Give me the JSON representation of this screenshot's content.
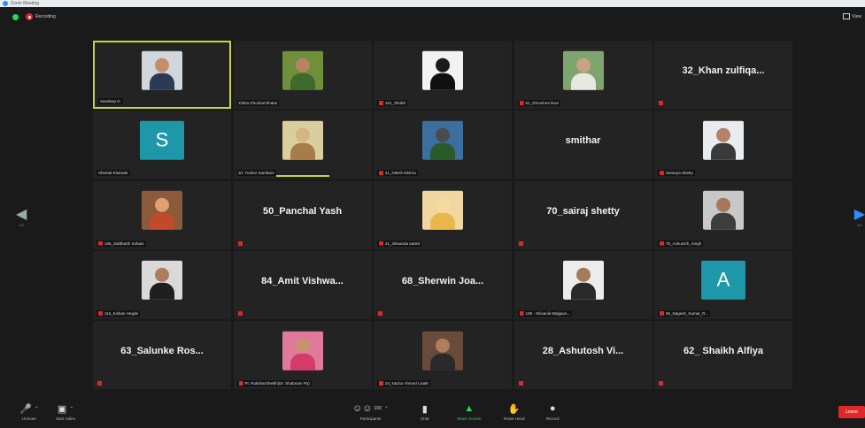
{
  "window": {
    "title": "Zoom Meeting"
  },
  "topbar": {
    "recording_label": "Recording",
    "view_label": "View"
  },
  "tiles": [
    {
      "kind": "photo",
      "label": "Sandeep D.",
      "muted": false,
      "active": true,
      "bg": "#cfd6dc",
      "body": "#2b3a55",
      "head": "#c58e68"
    },
    {
      "kind": "photo",
      "label": "Disha Ghoshal Bhatia",
      "muted": false,
      "bg": "#6f8f3a",
      "body": "#3f6a2a",
      "head": "#b98363"
    },
    {
      "kind": "photo",
      "label": "101_Shubh",
      "muted": true,
      "bg": "#f2f2f2",
      "body": "#111111",
      "head": "#1b1b1b"
    },
    {
      "kind": "photo",
      "label": "51_Ghrushna Ravi",
      "muted": true,
      "bg": "#7fa56f",
      "body": "#e8e8e0",
      "head": "#c9a184"
    },
    {
      "kind": "name",
      "name": "32_Khan zulfiqa...",
      "muted": true
    },
    {
      "kind": "letter",
      "letter": "S",
      "bg": "#1e98a8",
      "label": "Sheetal Kharade",
      "muted": false
    },
    {
      "kind": "photo",
      "label": "Dr. Tushar Sambare",
      "muted": false,
      "speaking": true,
      "bg": "#d9cf9e",
      "body": "#a87b4a",
      "head": "#d4b483"
    },
    {
      "kind": "photo",
      "label": "41_Nilesh Mishra",
      "muted": true,
      "bg": "#3a6f9e",
      "body": "#2a5a2a",
      "head": "#4b4b4b"
    },
    {
      "kind": "name",
      "name": "smithar",
      "muted": false
    },
    {
      "kind": "photo",
      "label": "Saranya Shetty",
      "muted": true,
      "bg": "#e9ecef",
      "body": "#3a3a3a",
      "head": "#b5816a"
    },
    {
      "kind": "photo",
      "label": "106_Siddharth Sohani",
      "muted": true,
      "bg": "#8a5a3a",
      "body": "#c24a2a",
      "head": "#e0a070"
    },
    {
      "kind": "name",
      "name": "50_Panchal Yash",
      "muted": true
    },
    {
      "kind": "photo",
      "label": "21_Ishnanda sankit",
      "muted": true,
      "bg": "#f0d7a0",
      "body": "#e8b84a",
      "head": "#f5d9a0"
    },
    {
      "kind": "name",
      "name": "70_sairaj shetty",
      "muted": true
    },
    {
      "kind": "photo",
      "label": "75_Ashutosh_Singh",
      "muted": true,
      "bg": "#c8c8c8",
      "body": "#3d3d3d",
      "head": "#a67758"
    },
    {
      "kind": "photo",
      "label": "116_Kishan Hegde",
      "muted": true,
      "bg": "#d9d9d9",
      "body": "#1f1f1f",
      "head": "#b07d5c"
    },
    {
      "kind": "name",
      "name": "84_Amit Vishwa...",
      "muted": true
    },
    {
      "kind": "name",
      "name": "68_Sherwin Joa...",
      "muted": true
    },
    {
      "kind": "photo",
      "label": "109 - Shivanik Malgaon...",
      "muted": true,
      "bg": "#ececec",
      "body": "#2a2a2a",
      "head": "#a57a5b"
    },
    {
      "kind": "letter",
      "letter": "A",
      "bg": "#1e98a8",
      "label": "96_Nagesh_Kumar_R...",
      "muted": true
    },
    {
      "kind": "name",
      "name": "63_Salunke Ros...",
      "muted": true
    },
    {
      "kind": "photo",
      "label": "Pr. RuksharSheikh(Dr. Shabnam Pa)",
      "muted": true,
      "bg": "#e07a9a",
      "body": "#d63a6a",
      "head": "#c9926e"
    },
    {
      "kind": "photo",
      "label": "24_Naziur Ahmed Lisatk",
      "muted": true,
      "bg": "#6a4a3a",
      "body": "#2a2a2a",
      "head": "#b07d5c"
    },
    {
      "kind": "name",
      "name": "28_Ashutosh Vi...",
      "muted": true
    },
    {
      "kind": "name",
      "name": "62_ Shaikh Alfiya",
      "muted": true
    }
  ],
  "nav": {
    "left_page": "1/2",
    "right_page": "1/2"
  },
  "toolbar": {
    "unmute_label": "Unmute",
    "start_video_label": "Start Video",
    "participants_label": "Participants",
    "participants_count": "193",
    "chat_label": "Chat",
    "share_label": "Share Screen",
    "raise_hand_label": "Raise Hand",
    "record_label": "Record",
    "leave_label": "Leave"
  },
  "colors": {
    "active_speaker": "#c9d43a",
    "share_green": "#23d959",
    "leave_red": "#e02828"
  }
}
